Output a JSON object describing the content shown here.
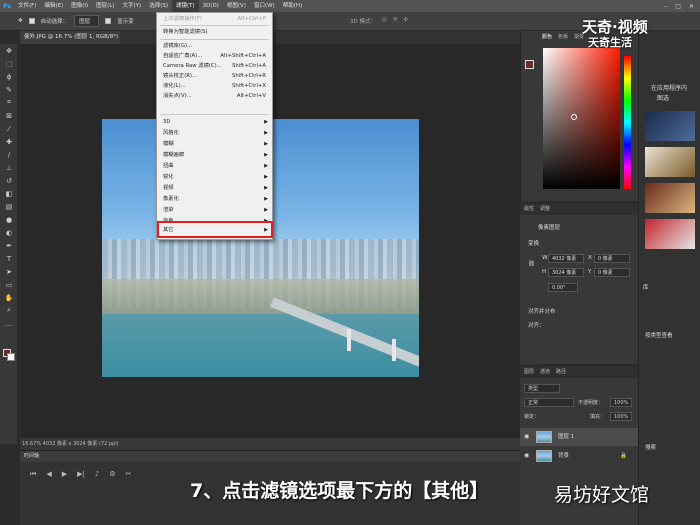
{
  "menubar": {
    "logo": "Ps",
    "items": [
      "文件(F)",
      "编辑(E)",
      "图像(I)",
      "图层(L)",
      "文字(Y)",
      "选择(S)",
      "滤镜(T)",
      "3D(D)",
      "视图(V)",
      "窗口(W)",
      "帮助(H)"
    ],
    "active_index": 6
  },
  "options_bar": {
    "auto_select_label": "自动选择：",
    "auto_select_value": "图层",
    "transform_label": "显示变",
    "mode_label": "3D 模式："
  },
  "tab": {
    "title": "曼外.JPG @ 16.7% (图层 1, RGB/8*) ×"
  },
  "filter_menu": {
    "items": [
      {
        "label": "上次滤镜操作(F)",
        "shortcut": "Alt+Ctrl+F",
        "disabled": true
      },
      {
        "label": "转换为智能滤镜(S)",
        "shortcut": ""
      },
      {
        "label": "滤镜库(G)...",
        "shortcut": ""
      },
      {
        "label": "自适应广角(A)...",
        "shortcut": "Alt+Shift+Ctrl+A"
      },
      {
        "label": "Camera Raw 滤镜(C)...",
        "shortcut": "Shift+Ctrl+A"
      },
      {
        "label": "镜头校正(R)...",
        "shortcut": "Shift+Ctrl+R"
      },
      {
        "label": "液化(L)...",
        "shortcut": "Shift+Ctrl+X"
      },
      {
        "label": "消失点(V)...",
        "shortcut": "Alt+Ctrl+V"
      },
      {
        "label": "3D",
        "submenu": true
      },
      {
        "label": "风格化",
        "submenu": true
      },
      {
        "label": "模糊",
        "submenu": true
      },
      {
        "label": "模糊画廊",
        "submenu": true
      },
      {
        "label": "扭曲",
        "submenu": true
      },
      {
        "label": "锐化",
        "submenu": true
      },
      {
        "label": "视频",
        "submenu": true
      },
      {
        "label": "像素化",
        "submenu": true
      },
      {
        "label": "渲染",
        "submenu": true
      },
      {
        "label": "杂色",
        "submenu": true
      },
      {
        "label": "其它",
        "submenu": true
      }
    ]
  },
  "statusbar": {
    "text": "16.67%    4032 像素 x 3024 像素 (72 ppi)"
  },
  "timeline": {
    "title": "时间轴"
  },
  "color_panel": {
    "tabs": [
      "颜色",
      "色板",
      "渐变"
    ],
    "foreground": "#6a2c26"
  },
  "properties_panel": {
    "tabs": [
      "属性",
      "调整"
    ],
    "layer_kind": "像素图层",
    "transform_label": "变换",
    "w_label": "W",
    "w_value": "4032 像素",
    "h_label": "H",
    "h_value": "3024 像素",
    "x_label": "X",
    "x_value": "0 像素",
    "y_label": "Y",
    "y_value": "0 像素",
    "angle": "0.00°",
    "align_label": "对齐并分布",
    "align_sub": "对齐："
  },
  "layers_panel": {
    "tabs": [
      "图层",
      "通道",
      "路径"
    ],
    "filter_kind": "类型",
    "blend_mode": "正常",
    "opacity_label": "不透明度：",
    "opacity_value": "100%",
    "lock_label": "锁定：",
    "fill_label": "填充：",
    "fill_value": "100%",
    "layers": [
      {
        "name": "图层 1",
        "selected": true
      },
      {
        "name": "背景",
        "selected": false
      }
    ]
  },
  "library_panel": {
    "line1": "在应用程序内",
    "line2": "图选",
    "sort_label": "按类型查看",
    "tab": "库",
    "search": "搜索"
  },
  "watermark_top": {
    "line1": "天奇·视频",
    "line2": "天奇生活"
  },
  "caption": {
    "text": "7、点击滤镜选项最下方的【其他】"
  },
  "watermark_bottom": {
    "text": "易坊好文馆"
  },
  "colors": {
    "highlight": "#e01e25",
    "accent": "#31a8ff"
  }
}
